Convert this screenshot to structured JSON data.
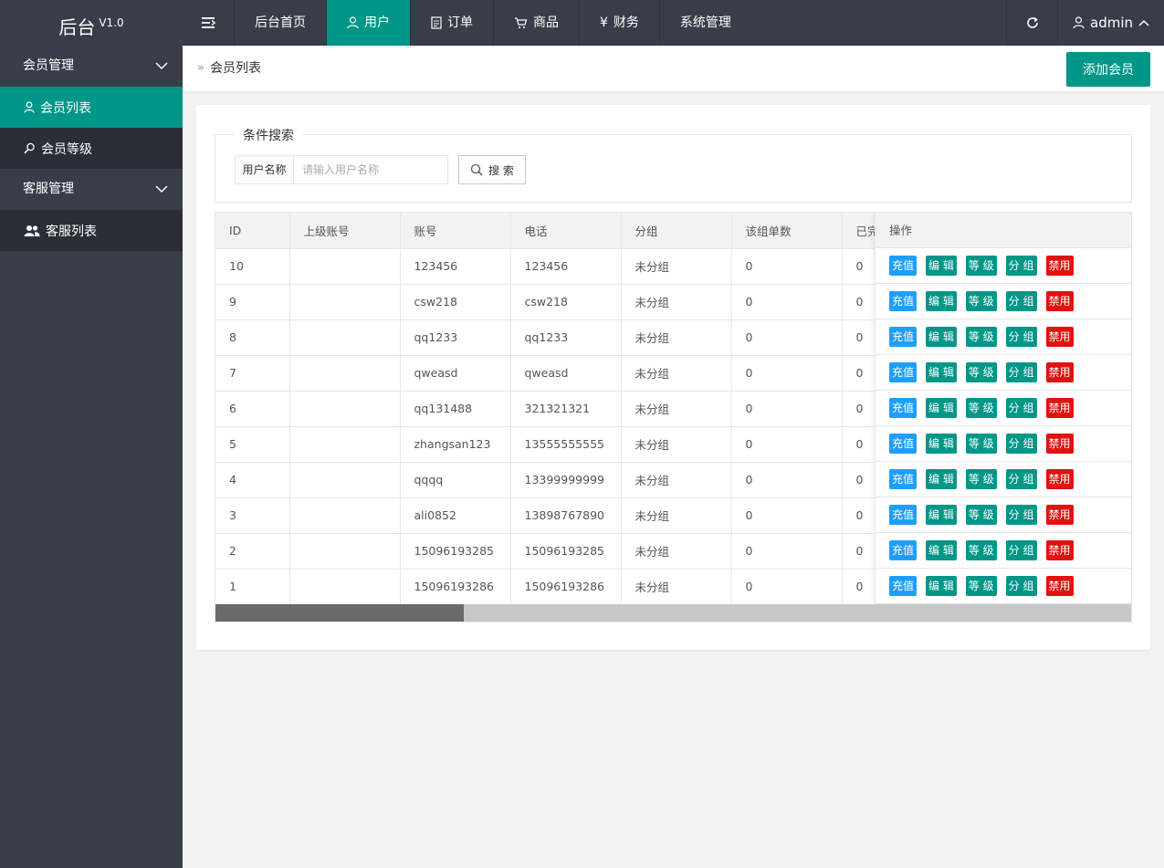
{
  "brand": {
    "title": "后台",
    "version": "V1.0"
  },
  "topnav": {
    "items": [
      {
        "label": "后台首页"
      },
      {
        "label": "用户"
      },
      {
        "label": "订单"
      },
      {
        "label": "商品"
      },
      {
        "label": "财务"
      },
      {
        "label": "系统管理"
      }
    ],
    "user": "admin"
  },
  "sidebar": {
    "groups": [
      {
        "label": "会员管理",
        "items": [
          {
            "label": "会员列表"
          },
          {
            "label": "会员等级"
          }
        ]
      },
      {
        "label": "客服管理",
        "items": [
          {
            "label": "客服列表"
          }
        ]
      }
    ]
  },
  "breadcrumb": {
    "current": "会员列表"
  },
  "header": {
    "add_label": "添加会员"
  },
  "search": {
    "legend": "条件搜索",
    "field_label": "用户名称",
    "placeholder": "请输入用户名称",
    "value": "",
    "button_label": "搜 索"
  },
  "table": {
    "columns": [
      "ID",
      "上级账号",
      "账号",
      "电话",
      "分组",
      "该组单数",
      "已完",
      "操作"
    ],
    "rows": [
      [
        "10",
        "",
        "123456",
        "123456",
        "未分组",
        "0",
        "0"
      ],
      [
        "9",
        "",
        "csw218",
        "csw218",
        "未分组",
        "0",
        "0"
      ],
      [
        "8",
        "",
        "qq1233",
        "qq1233",
        "未分组",
        "0",
        "0"
      ],
      [
        "7",
        "",
        "qweasd",
        "qweasd",
        "未分组",
        "0",
        "0"
      ],
      [
        "6",
        "",
        "qq131488",
        "321321321",
        "未分组",
        "0",
        "0"
      ],
      [
        "5",
        "",
        "zhangsan123",
        "13555555555",
        "未分组",
        "0",
        "0"
      ],
      [
        "4",
        "",
        "qqqq",
        "13399999999",
        "未分组",
        "0",
        "0"
      ],
      [
        "3",
        "",
        "ali0852",
        "13898767890",
        "未分组",
        "0",
        "0"
      ],
      [
        "2",
        "",
        "15096193285",
        "15096193285",
        "未分组",
        "0",
        "0"
      ],
      [
        "1",
        "",
        "15096193286",
        "15096193286",
        "未分组",
        "0",
        "0"
      ]
    ],
    "actions": [
      "充值",
      "编 辑",
      "等 级",
      "分 组",
      "禁用"
    ],
    "scroll_position": 0.27
  },
  "colors": {
    "primary": "#009688",
    "dark": "#393d49",
    "charge": "#1e9fff",
    "danger": "#e1120f"
  }
}
